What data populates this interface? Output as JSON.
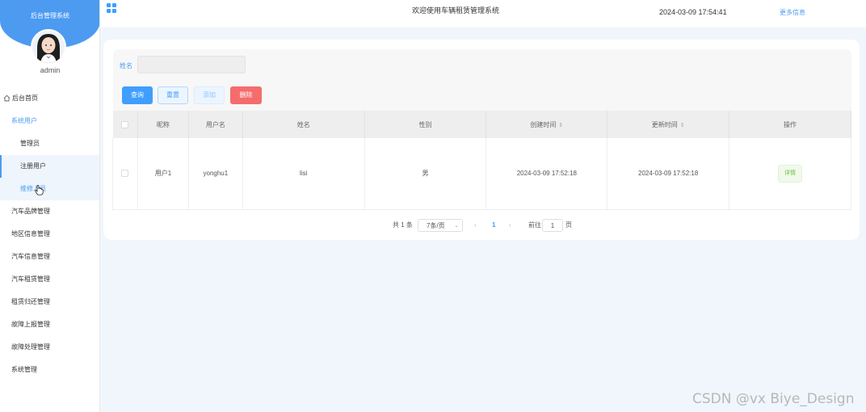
{
  "sidebar": {
    "brand_title": "后台管理系统",
    "admin_name": "admin",
    "items": [
      {
        "label": "后台首页"
      },
      {
        "label": "系统用户"
      },
      {
        "label": "管理员"
      },
      {
        "label": "注册用户"
      },
      {
        "label": "维修人员"
      },
      {
        "label": "汽车品牌管理"
      },
      {
        "label": "地区信息管理"
      },
      {
        "label": "汽车信息管理"
      },
      {
        "label": "汽车租赁管理"
      },
      {
        "label": "租赁归还管理"
      },
      {
        "label": "故障上报管理"
      },
      {
        "label": "故障处理管理"
      },
      {
        "label": "系统管理"
      }
    ]
  },
  "header": {
    "title": "欢迎使用车辆租赁管理系统",
    "datetime": "2024-03-09 17:54:41",
    "more": "更多信息"
  },
  "search": {
    "label": "姓名",
    "value": "",
    "placeholder": ""
  },
  "buttons": {
    "query": "查询",
    "reset": "重置",
    "add": "添加",
    "delete": "删除"
  },
  "table": {
    "columns": [
      "昵称",
      "用户名",
      "姓名",
      "性别",
      "创建时间",
      "更新时间",
      "操作"
    ],
    "sort_glyph": "⇕",
    "rows": [
      {
        "nickname": "用户1",
        "username": "yonghu1",
        "name": "lisi",
        "gender": "男",
        "created": "2024-03-09 17:52:18",
        "updated": "2024-03-09 17:52:18",
        "action": "详情"
      }
    ]
  },
  "pagination": {
    "total": "共 1 条",
    "page_size": "7条/页",
    "current_page": "1",
    "goto_label": "前往",
    "goto_value": "1",
    "page_suffix": "页"
  },
  "watermark": "CSDN @vx Biye_Design",
  "colors": {
    "accent": "#409eff",
    "brand": "#4c9bf0",
    "danger": "#f56c6c",
    "success": "#67c23a"
  }
}
